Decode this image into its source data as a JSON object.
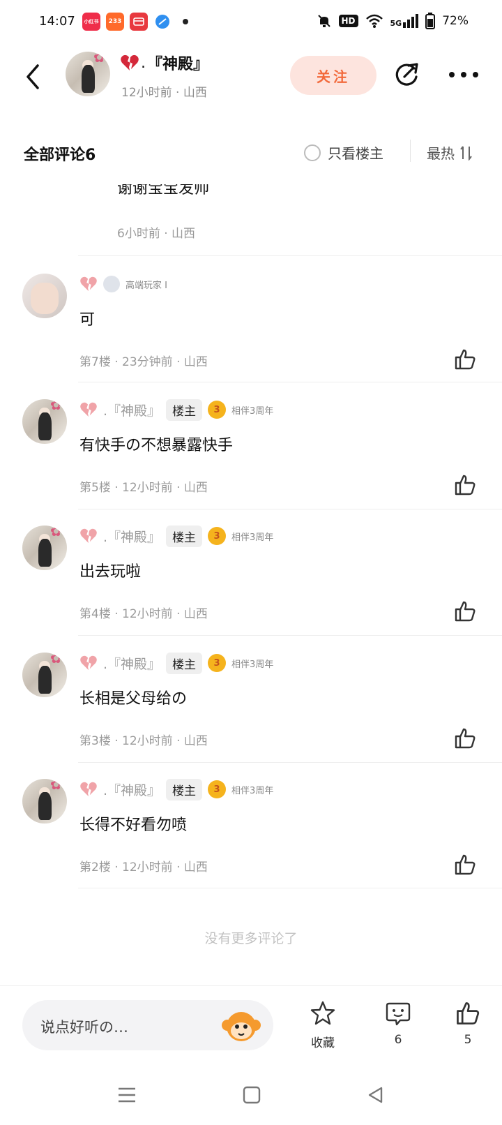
{
  "status": {
    "time": "14:07",
    "app_icons": [
      {
        "name": "xiaohongshu-app-icon",
        "text": "小红书",
        "color": "#ef2d4a"
      },
      {
        "name": "233-app-icon",
        "text": "233",
        "color": "#ff6a2b"
      },
      {
        "name": "wallet-app-icon",
        "text": "",
        "color": "#e8393f"
      },
      {
        "name": "browser-app-icon",
        "text": "",
        "color": "#2f8ff0"
      }
    ],
    "hd": "HD",
    "network": "5G",
    "battery": "72%"
  },
  "header": {
    "author_name": "『神殿』",
    "author_prefix": ".",
    "author_meta": "12小时前 · 山西",
    "follow_label": "关注"
  },
  "comments_header": {
    "title": "全部评论6",
    "only_owner_label": "只看楼主",
    "sort_label": "最热"
  },
  "partial_reply": {
    "text": "谢谢宝宝发帅",
    "meta": "6小时前 · 山西"
  },
  "comments": [
    {
      "name": "",
      "user_tag": "高端玩家 I",
      "text": "可",
      "meta": "第7楼 · 23分钟前 · 山西",
      "is_owner": false
    },
    {
      "name": ".『神殿』",
      "owner_badge": "楼主",
      "medal_text": "相伴3周年",
      "text": "有快手の不想暴露快手",
      "meta": "第5楼 · 12小时前 · 山西",
      "is_owner": true
    },
    {
      "name": ".『神殿』",
      "owner_badge": "楼主",
      "medal_text": "相伴3周年",
      "text": "出去玩啦",
      "meta": "第4楼 · 12小时前 · 山西",
      "is_owner": true
    },
    {
      "name": ".『神殿』",
      "owner_badge": "楼主",
      "medal_text": "相伴3周年",
      "text": "长相是父母给の",
      "meta": "第3楼 · 12小时前 · 山西",
      "is_owner": true
    },
    {
      "name": ".『神殿』",
      "owner_badge": "楼主",
      "medal_text": "相伴3周年",
      "text": "长得不好看勿喷",
      "meta": "第2楼 · 12小时前 · 山西",
      "is_owner": true
    }
  ],
  "no_more_text": "没有更多评论了",
  "bottom_bar": {
    "input_placeholder": "说点好听の…",
    "favorite_label": "收藏",
    "comment_count": "6",
    "like_count": "5"
  },
  "colors": {
    "accent": "#f26a3c",
    "follow_bg": "#fde4de",
    "heart": "#f0a3a8"
  }
}
